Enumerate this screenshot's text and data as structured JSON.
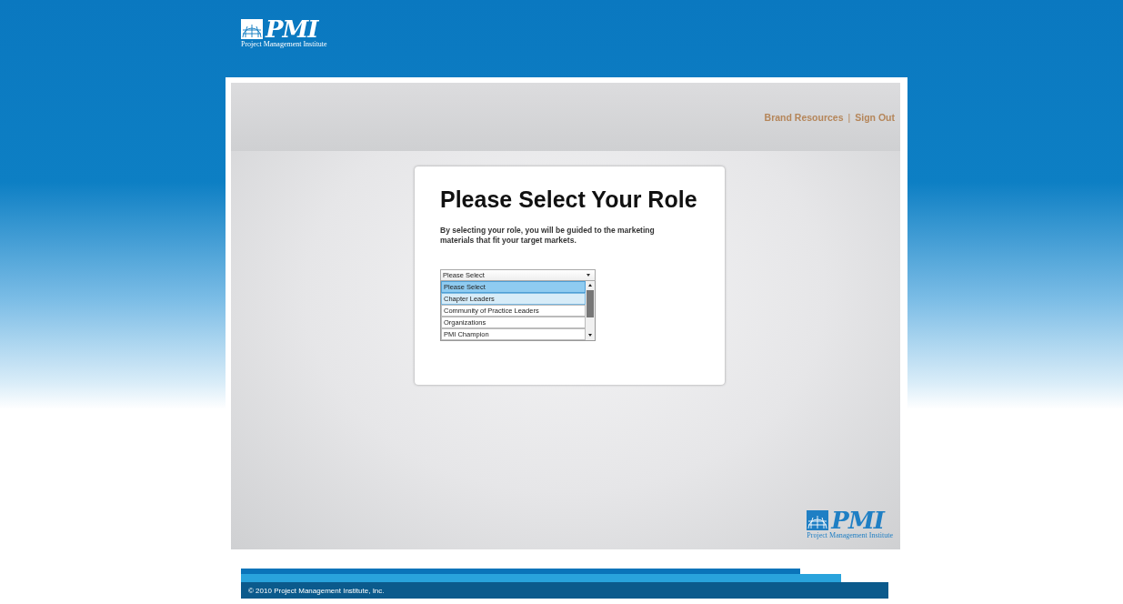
{
  "header_logo": {
    "mark": "PMI",
    "tagline": "Project Management Institute"
  },
  "top_links": [
    "Brand Resources",
    "Sign Out"
  ],
  "top_links_separator": "|",
  "card": {
    "title": "Please Select Your Role",
    "description": "By selecting your role, you will be guided to the marketing materials that fit your target markets."
  },
  "role_select": {
    "value": "Please Select",
    "expanded": true,
    "options": [
      {
        "label": "Please Select",
        "selected": true,
        "highlighted": false
      },
      {
        "label": "Chapter Leaders",
        "selected": false,
        "highlighted": true
      },
      {
        "label": "Community of Practice Leaders",
        "selected": false,
        "highlighted": false
      },
      {
        "label": "Organizations",
        "selected": false,
        "highlighted": false
      },
      {
        "label": "PMI Champion",
        "selected": false,
        "highlighted": false
      }
    ]
  },
  "footer_logo": {
    "mark": "PMI",
    "tagline": "Project Management Institute"
  },
  "footer": {
    "copyright": "© 2010 Project Management Institute, Inc."
  }
}
